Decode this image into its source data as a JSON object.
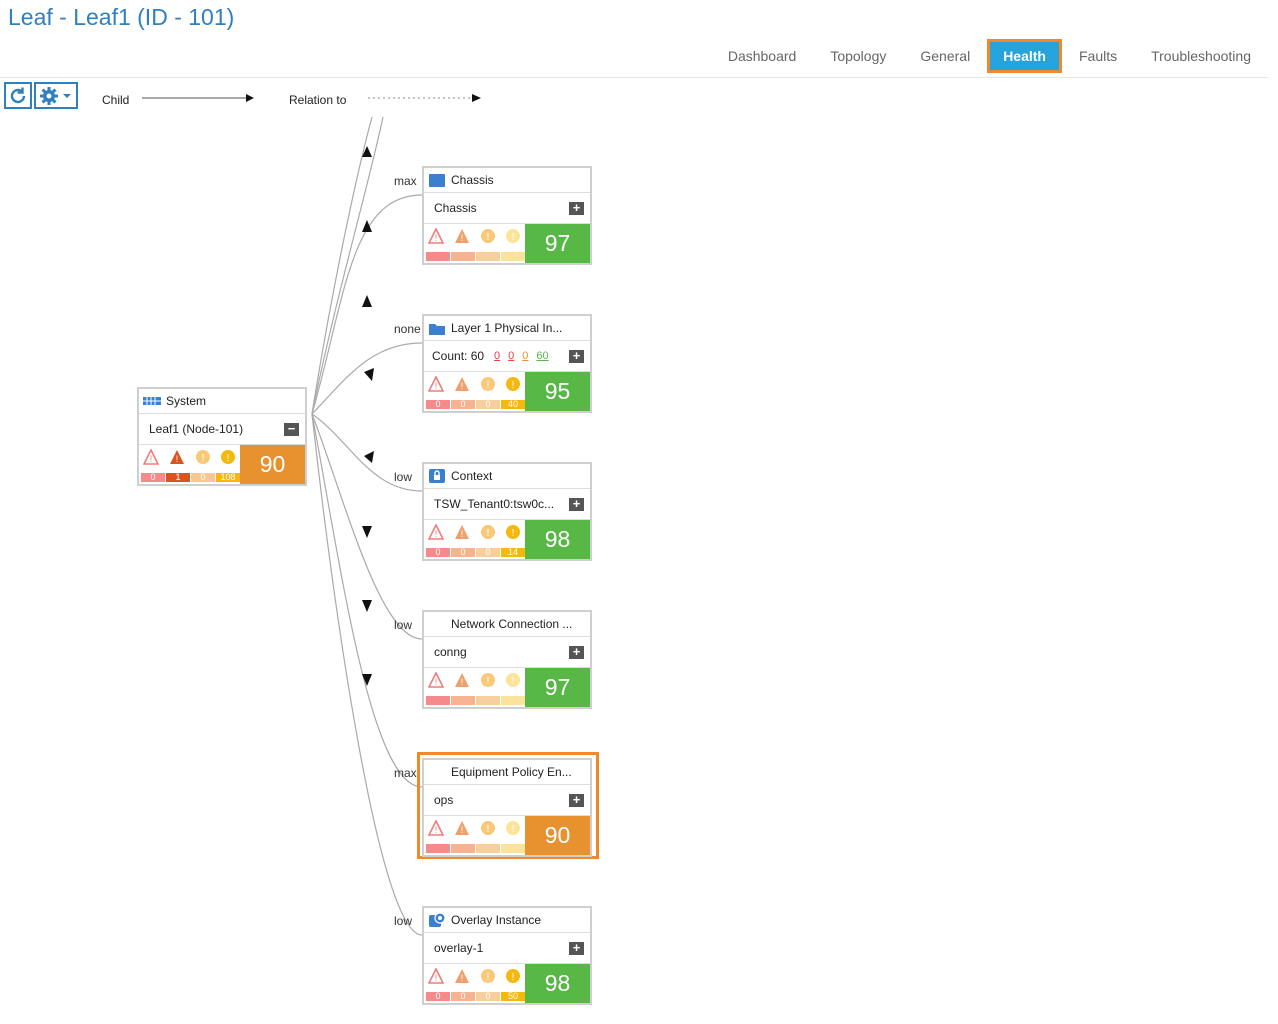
{
  "title": "Leaf - Leaf1 (ID - 101)",
  "tabs": [
    "Dashboard",
    "Topology",
    "General",
    "Health",
    "Faults",
    "Troubleshooting"
  ],
  "active_tab": "Health",
  "legend": {
    "child": "Child",
    "relation": "Relation to"
  },
  "root": {
    "type": "System",
    "label": "Leaf1 (Node-101)",
    "score": "90",
    "faults": [
      "0",
      "1",
      "0",
      "108"
    ]
  },
  "children": [
    {
      "rel": "max",
      "type": "Chassis",
      "label": "Chassis",
      "score": "97",
      "faults": [
        "",
        "",
        "",
        ""
      ],
      "count": null
    },
    {
      "rel": "none",
      "type": "Layer 1 Physical In...",
      "label": "Count: 60",
      "score": "95",
      "faults": [
        "0",
        "0",
        "0",
        "40"
      ],
      "count": [
        "0",
        "0",
        "0",
        "60"
      ]
    },
    {
      "rel": "low",
      "type": "Context",
      "label": "TSW_Tenant0:tsw0c...",
      "score": "98",
      "faults": [
        "0",
        "0",
        "0",
        "14"
      ],
      "count": null
    },
    {
      "rel": "low",
      "type": "Network Connection ...",
      "label": "conng",
      "score": "97",
      "faults": [
        "",
        "",
        "",
        ""
      ],
      "count": null
    },
    {
      "rel": "max",
      "type": "Equipment Policy En...",
      "label": "ops",
      "score": "90",
      "faults": [
        "",
        "",
        "",
        ""
      ],
      "count": null
    },
    {
      "rel": "low",
      "type": "Overlay Instance",
      "label": "overlay-1",
      "score": "98",
      "faults": [
        "0",
        "0",
        "0",
        "50"
      ],
      "count": null
    }
  ]
}
